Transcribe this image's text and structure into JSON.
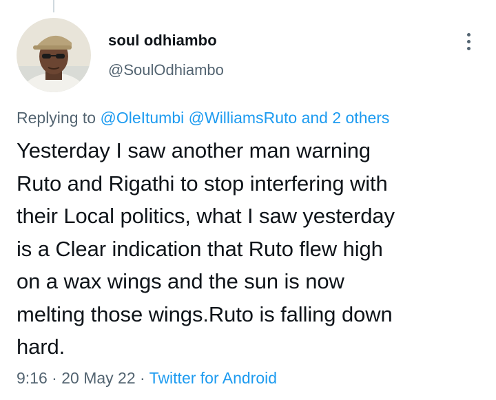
{
  "author": {
    "name": "soul odhiambo",
    "handle": "@SoulOdhiambo"
  },
  "reply": {
    "prefix": "Replying to",
    "mentions": [
      "@OleItumbi",
      "@WilliamsRuto"
    ],
    "others": "and 2 others"
  },
  "tweet": {
    "text": "Yesterday I saw another man warning\nRuto and Rigathi to stop interfering with\ntheir Local politics, what I saw yesterday\nis a Clear indication  that Ruto flew high\non a wax wings and the sun is now\nmelting those wings.Ruto is falling down\nhard."
  },
  "meta": {
    "time": "9:16",
    "separator": "·",
    "date": "20 May 22",
    "source": "Twitter for Android"
  },
  "colors": {
    "link": "#1d9bf0",
    "secondary_text": "#536471",
    "primary_text": "#0f1419"
  },
  "icons": {
    "more": "more-vertical-icon"
  }
}
